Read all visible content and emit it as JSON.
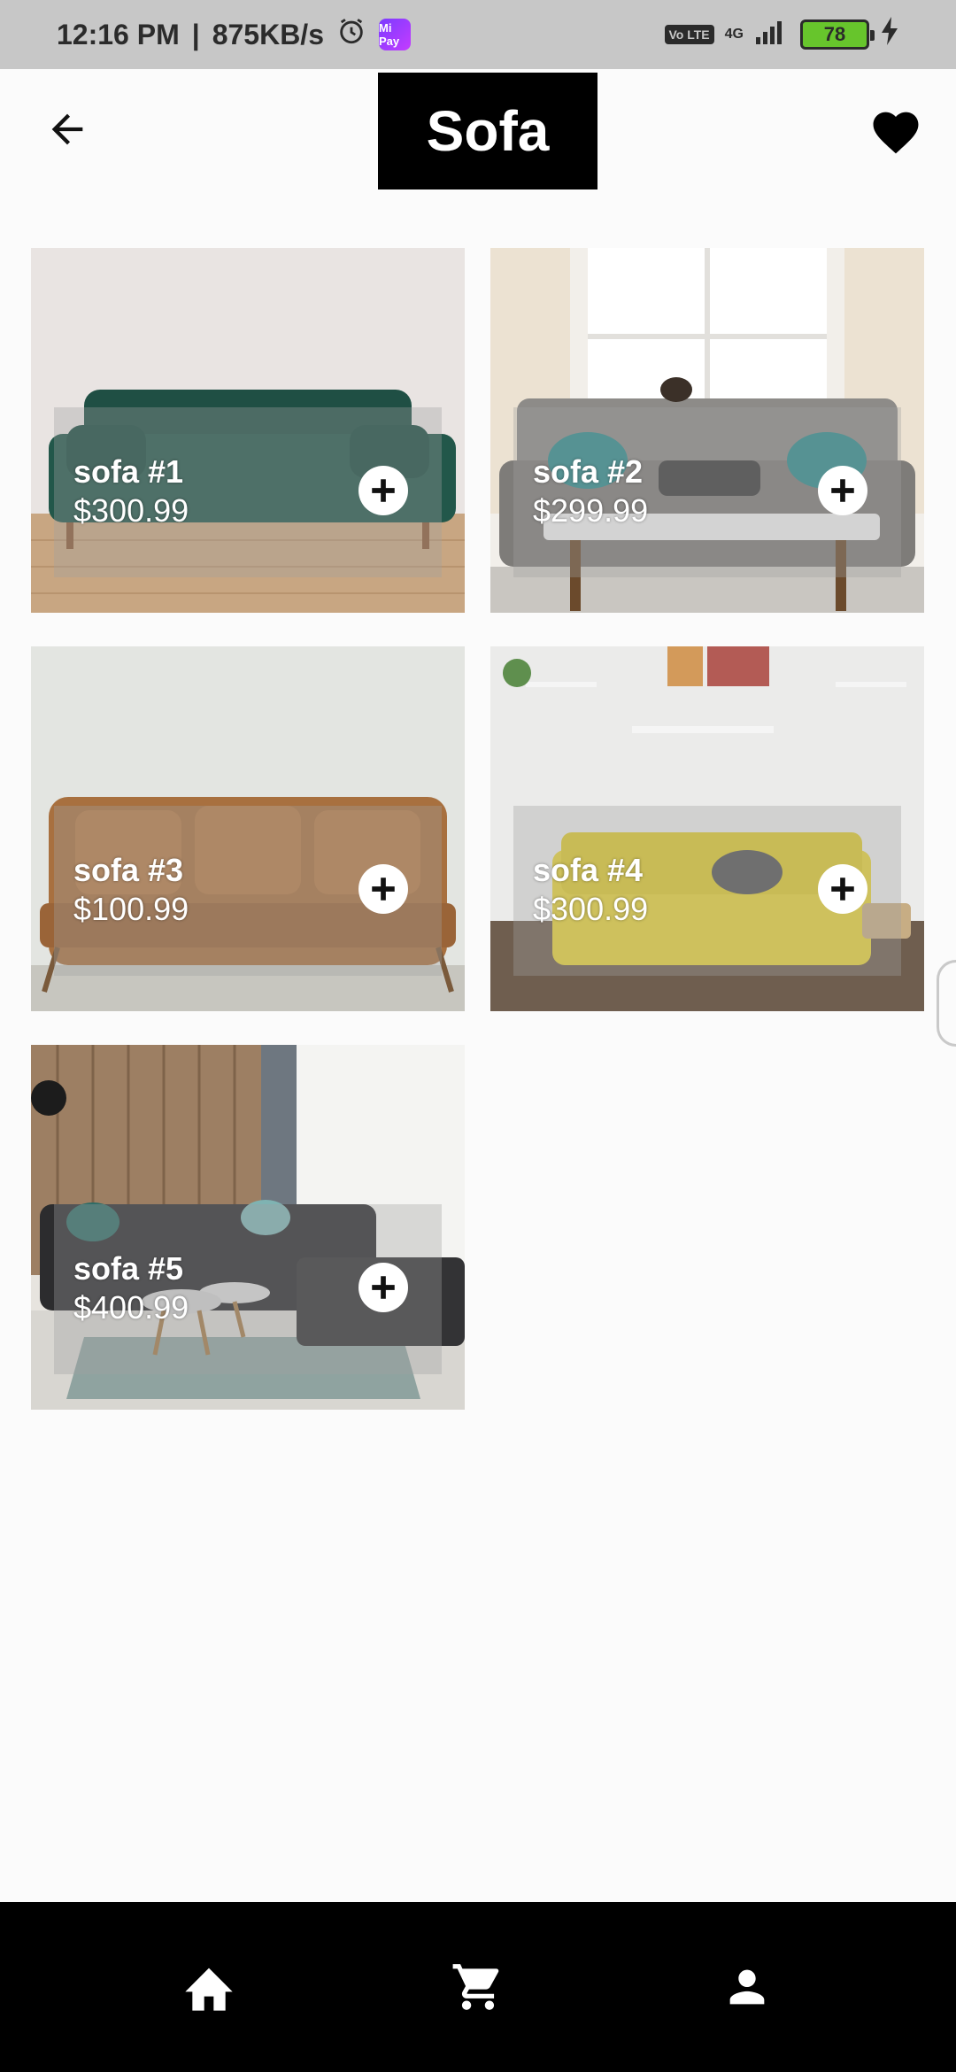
{
  "status_bar": {
    "time": "12:16 PM",
    "separator": "|",
    "speed": "875KB/s",
    "mipay_label": "Mi Pay",
    "volte_label": "Vo LTE",
    "network": "4G",
    "battery": "78"
  },
  "header": {
    "title": "Sofa",
    "back_icon": "arrow-left-icon",
    "favorite_icon": "heart-icon"
  },
  "products": [
    {
      "name": "sofa #1",
      "price": "$300.99"
    },
    {
      "name": "sofa #2",
      "price": "$299.99"
    },
    {
      "name": "sofa #3",
      "price": "$100.99"
    },
    {
      "name": "sofa #4",
      "price": "$300.99"
    },
    {
      "name": "sofa #5",
      "price": "$400.99"
    }
  ],
  "bottom_nav": {
    "items": [
      {
        "icon": "home-icon"
      },
      {
        "icon": "cart-icon"
      },
      {
        "icon": "person-icon"
      }
    ]
  },
  "colors": {
    "status_bar_bg": "#c7c7c7",
    "app_bg": "#fbfbfb",
    "title_bg": "#000000",
    "nav_bg": "#000000",
    "battery_fill": "#67c52c"
  }
}
